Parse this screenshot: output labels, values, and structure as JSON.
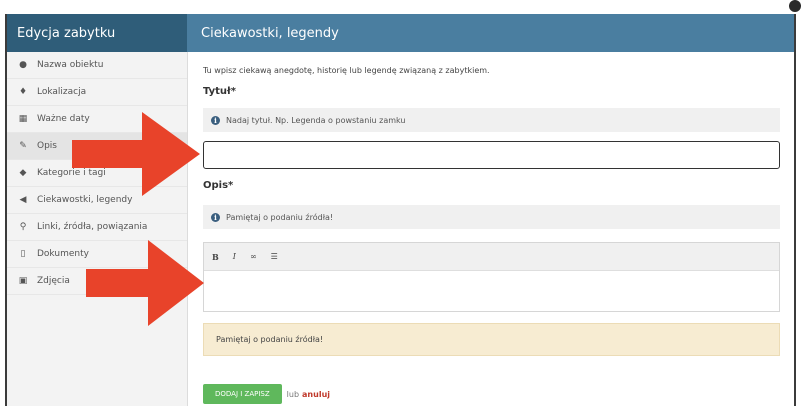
{
  "sidebar": {
    "title": "Edycja zabytku",
    "items": [
      {
        "label": "Nazwa obiektu",
        "icon": "info-circle-icon",
        "glyph": "●"
      },
      {
        "label": "Lokalizacja",
        "icon": "map-pin-icon",
        "glyph": "♦"
      },
      {
        "label": "Ważne daty",
        "icon": "calendar-icon",
        "glyph": "▦"
      },
      {
        "label": "Opis",
        "icon": "edit-icon",
        "glyph": "✎"
      },
      {
        "label": "Kategorie i tagi",
        "icon": "tag-icon",
        "glyph": "◆"
      },
      {
        "label": "Ciekawostki, legendy",
        "icon": "bullhorn-icon",
        "glyph": "◀"
      },
      {
        "label": "Linki, źródła, powiązania",
        "icon": "link-icon",
        "glyph": "⚲"
      },
      {
        "label": "Dokumenty",
        "icon": "document-icon",
        "glyph": "▯"
      },
      {
        "label": "Zdjęcia",
        "icon": "image-icon",
        "glyph": "▣"
      }
    ]
  },
  "main": {
    "title": "Ciekawostki, legendy",
    "intro": "Tu wpisz ciekawą anegdotę, historię lub legendę związaną z zabytkiem.",
    "title_label": "Tytuł*",
    "title_hint": "Nadaj tytuł. Np. Legenda o powstaniu zamku",
    "title_value": "",
    "desc_label": "Opis*",
    "desc_hint": "Pamiętaj o podaniu źródła!",
    "toolbar": {
      "bold": "B",
      "italic": "I",
      "link": "∞",
      "list": "☰"
    },
    "warning": "Pamiętaj o podaniu źródła!",
    "submit": "DODAJ I ZAPISZ",
    "or": "lub",
    "cancel": "anuluj"
  },
  "colors": {
    "sidebar_header": "#2f5d79",
    "main_header": "#4a7ea0",
    "arrow": "#e8432a",
    "submit": "#5fb85c",
    "warning_bg": "#f7ecd2"
  }
}
